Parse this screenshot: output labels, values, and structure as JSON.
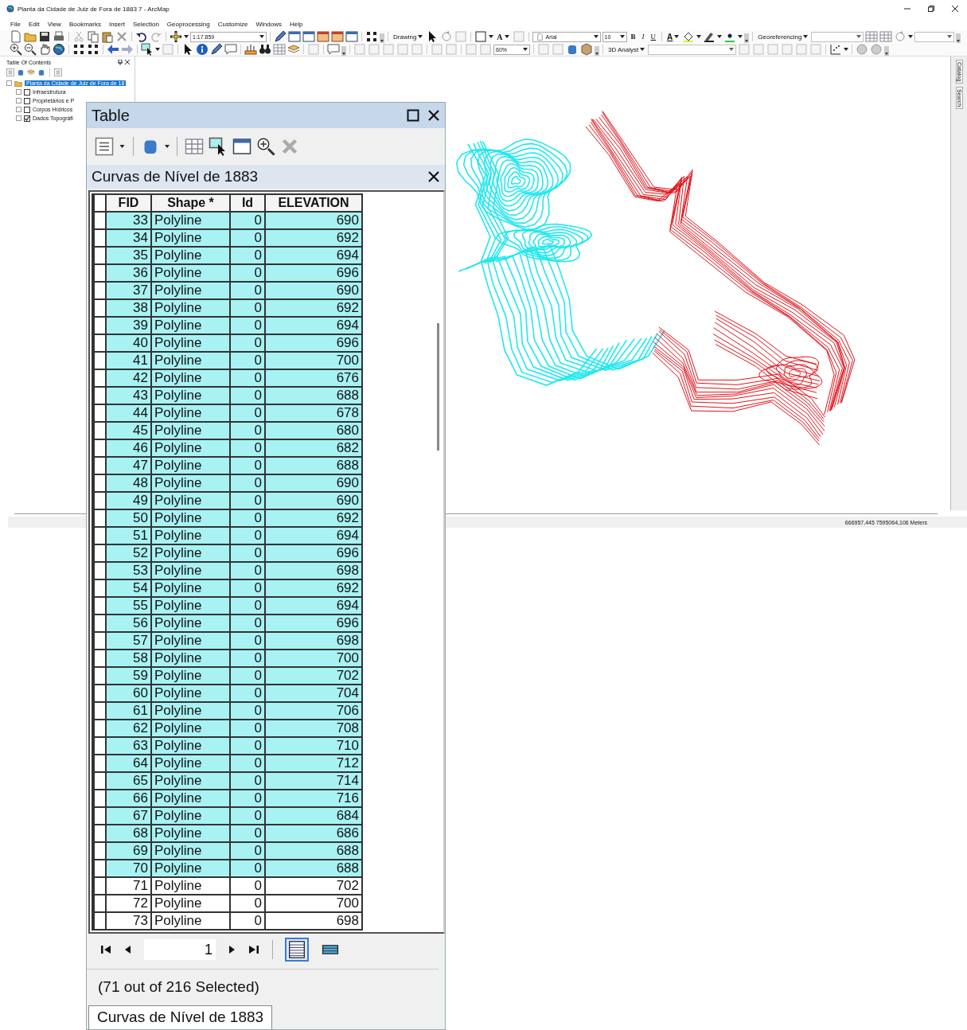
{
  "window": {
    "title": "Planta da Cidade de Juiz de Fora de 1883 7 - ArcMap"
  },
  "menu": [
    "File",
    "Edit",
    "View",
    "Bookmarks",
    "Insert",
    "Selection",
    "Geoprocessing",
    "Customize",
    "Windows",
    "Help"
  ],
  "toolbars": {
    "scale": "1:17.859",
    "drawing": "Drawing",
    "text_tool": "A",
    "font": "Arial",
    "font_size": "10",
    "bold": "B",
    "italic": "I",
    "underline": "U",
    "font_color": "A",
    "georeferencing": "Georeferencing",
    "zoom_percent": "60%",
    "analyst": "3D Analyst"
  },
  "toc": {
    "title": "Table Of Contents",
    "map": "Planta da Cidade de Juiz de Fora de 18",
    "layers": [
      {
        "name": "Infraestrutura",
        "checked": false
      },
      {
        "name": "Proprietários e P",
        "checked": false
      },
      {
        "name": "Corpos Hídricos",
        "checked": false
      },
      {
        "name": "Dados Topográfi",
        "checked": true
      }
    ]
  },
  "side_tabs": [
    "Catalog",
    "Search"
  ],
  "status_bar": {
    "coordinates": "666957,445  7595064,106 Meters"
  },
  "table": {
    "title": "Table",
    "layer": "Curvas de Nível de 1883",
    "columns": [
      "FID",
      "Shape *",
      "Id",
      "ELEVATION"
    ],
    "rows": [
      {
        "fid": "33",
        "shape": "Polyline",
        "id": "0",
        "elevation": "690",
        "selected": true
      },
      {
        "fid": "34",
        "shape": "Polyline",
        "id": "0",
        "elevation": "692",
        "selected": true
      },
      {
        "fid": "35",
        "shape": "Polyline",
        "id": "0",
        "elevation": "694",
        "selected": true
      },
      {
        "fid": "36",
        "shape": "Polyline",
        "id": "0",
        "elevation": "696",
        "selected": true
      },
      {
        "fid": "37",
        "shape": "Polyline",
        "id": "0",
        "elevation": "690",
        "selected": true
      },
      {
        "fid": "38",
        "shape": "Polyline",
        "id": "0",
        "elevation": "692",
        "selected": true
      },
      {
        "fid": "39",
        "shape": "Polyline",
        "id": "0",
        "elevation": "694",
        "selected": true
      },
      {
        "fid": "40",
        "shape": "Polyline",
        "id": "0",
        "elevation": "696",
        "selected": true
      },
      {
        "fid": "41",
        "shape": "Polyline",
        "id": "0",
        "elevation": "700",
        "selected": true
      },
      {
        "fid": "42",
        "shape": "Polyline",
        "id": "0",
        "elevation": "676",
        "selected": true
      },
      {
        "fid": "43",
        "shape": "Polyline",
        "id": "0",
        "elevation": "688",
        "selected": true
      },
      {
        "fid": "44",
        "shape": "Polyline",
        "id": "0",
        "elevation": "678",
        "selected": true
      },
      {
        "fid": "45",
        "shape": "Polyline",
        "id": "0",
        "elevation": "680",
        "selected": true
      },
      {
        "fid": "46",
        "shape": "Polyline",
        "id": "0",
        "elevation": "682",
        "selected": true
      },
      {
        "fid": "47",
        "shape": "Polyline",
        "id": "0",
        "elevation": "688",
        "selected": true
      },
      {
        "fid": "48",
        "shape": "Polyline",
        "id": "0",
        "elevation": "690",
        "selected": true
      },
      {
        "fid": "49",
        "shape": "Polyline",
        "id": "0",
        "elevation": "690",
        "selected": true
      },
      {
        "fid": "50",
        "shape": "Polyline",
        "id": "0",
        "elevation": "692",
        "selected": true
      },
      {
        "fid": "51",
        "shape": "Polyline",
        "id": "0",
        "elevation": "694",
        "selected": true
      },
      {
        "fid": "52",
        "shape": "Polyline",
        "id": "0",
        "elevation": "696",
        "selected": true
      },
      {
        "fid": "53",
        "shape": "Polyline",
        "id": "0",
        "elevation": "698",
        "selected": true
      },
      {
        "fid": "54",
        "shape": "Polyline",
        "id": "0",
        "elevation": "692",
        "selected": true
      },
      {
        "fid": "55",
        "shape": "Polyline",
        "id": "0",
        "elevation": "694",
        "selected": true
      },
      {
        "fid": "56",
        "shape": "Polyline",
        "id": "0",
        "elevation": "696",
        "selected": true
      },
      {
        "fid": "57",
        "shape": "Polyline",
        "id": "0",
        "elevation": "698",
        "selected": true
      },
      {
        "fid": "58",
        "shape": "Polyline",
        "id": "0",
        "elevation": "700",
        "selected": true
      },
      {
        "fid": "59",
        "shape": "Polyline",
        "id": "0",
        "elevation": "702",
        "selected": true
      },
      {
        "fid": "60",
        "shape": "Polyline",
        "id": "0",
        "elevation": "704",
        "selected": true
      },
      {
        "fid": "61",
        "shape": "Polyline",
        "id": "0",
        "elevation": "706",
        "selected": true
      },
      {
        "fid": "62",
        "shape": "Polyline",
        "id": "0",
        "elevation": "708",
        "selected": true
      },
      {
        "fid": "63",
        "shape": "Polyline",
        "id": "0",
        "elevation": "710",
        "selected": true
      },
      {
        "fid": "64",
        "shape": "Polyline",
        "id": "0",
        "elevation": "712",
        "selected": true
      },
      {
        "fid": "65",
        "shape": "Polyline",
        "id": "0",
        "elevation": "714",
        "selected": true
      },
      {
        "fid": "66",
        "shape": "Polyline",
        "id": "0",
        "elevation": "716",
        "selected": true
      },
      {
        "fid": "67",
        "shape": "Polyline",
        "id": "0",
        "elevation": "684",
        "selected": true
      },
      {
        "fid": "68",
        "shape": "Polyline",
        "id": "0",
        "elevation": "686",
        "selected": true
      },
      {
        "fid": "69",
        "shape": "Polyline",
        "id": "0",
        "elevation": "688",
        "selected": true
      },
      {
        "fid": "70",
        "shape": "Polyline",
        "id": "0",
        "elevation": "688",
        "selected": true
      },
      {
        "fid": "71",
        "shape": "Polyline",
        "id": "0",
        "elevation": "702",
        "selected": false
      },
      {
        "fid": "72",
        "shape": "Polyline",
        "id": "0",
        "elevation": "700",
        "selected": false
      },
      {
        "fid": "73",
        "shape": "Polyline",
        "id": "0",
        "elevation": "698",
        "selected": false
      }
    ],
    "record": "1",
    "views": [
      {
        "selected": true
      },
      {
        "selected": false
      }
    ],
    "summary": "(71 out of 216 Selected)",
    "tab": "Curvas de Nível de 1883"
  }
}
